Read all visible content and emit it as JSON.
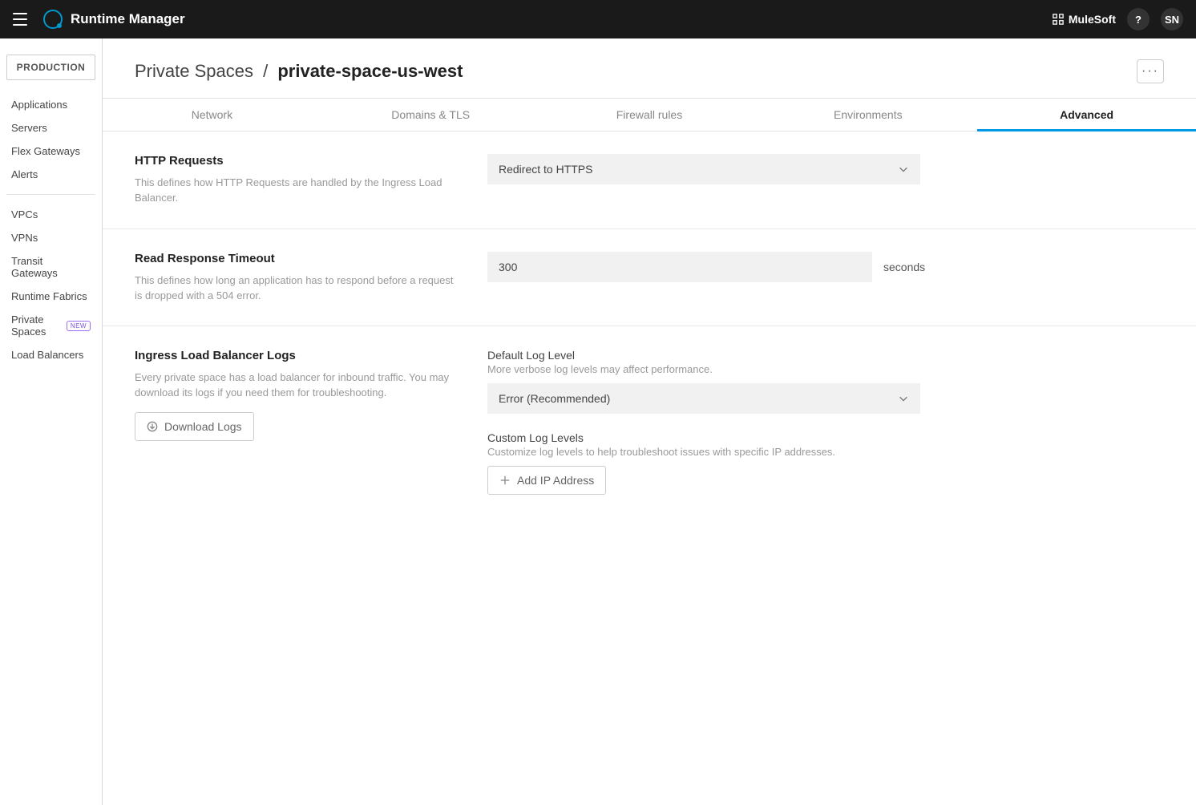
{
  "topbar": {
    "app_title": "Runtime Manager",
    "brand_link": "MuleSoft",
    "help_label": "?",
    "avatar_initials": "SN"
  },
  "sidebar": {
    "env_label": "PRODUCTION",
    "group1": [
      "Applications",
      "Servers",
      "Flex Gateways",
      "Alerts"
    ],
    "group2": [
      {
        "label": "VPCs"
      },
      {
        "label": "VPNs"
      },
      {
        "label": "Transit Gateways"
      },
      {
        "label": "Runtime Fabrics"
      },
      {
        "label": "Private Spaces",
        "badge": "NEW"
      },
      {
        "label": "Load Balancers"
      }
    ]
  },
  "breadcrumb": {
    "parent": "Private Spaces",
    "sep": "/",
    "current": "private-space-us-west"
  },
  "tabs": [
    "Network",
    "Domains & TLS",
    "Firewall rules",
    "Environments",
    "Advanced"
  ],
  "active_tab_index": 4,
  "sections": {
    "http": {
      "title": "HTTP Requests",
      "desc": "This defines how HTTP Requests are handled by the Ingress Load Balancer.",
      "select_value": "Redirect to HTTPS"
    },
    "timeout": {
      "title": "Read Response Timeout",
      "desc": "This defines how long an application has to respond before a request is dropped with a 504 error.",
      "input_value": "300",
      "unit": "seconds"
    },
    "logs": {
      "title": "Ingress Load Balancer Logs",
      "desc": "Every private space has a load balancer for inbound traffic. You may download its logs if you need them for troubleshooting.",
      "download_label": "Download Logs",
      "default_level_label": "Default Log Level",
      "default_level_hint": "More verbose log levels may affect performance.",
      "default_level_value": "Error (Recommended)",
      "custom_level_label": "Custom Log Levels",
      "custom_level_hint": "Customize log levels to help troubleshoot issues with specific IP addresses.",
      "add_ip_label": "Add IP Address"
    }
  }
}
